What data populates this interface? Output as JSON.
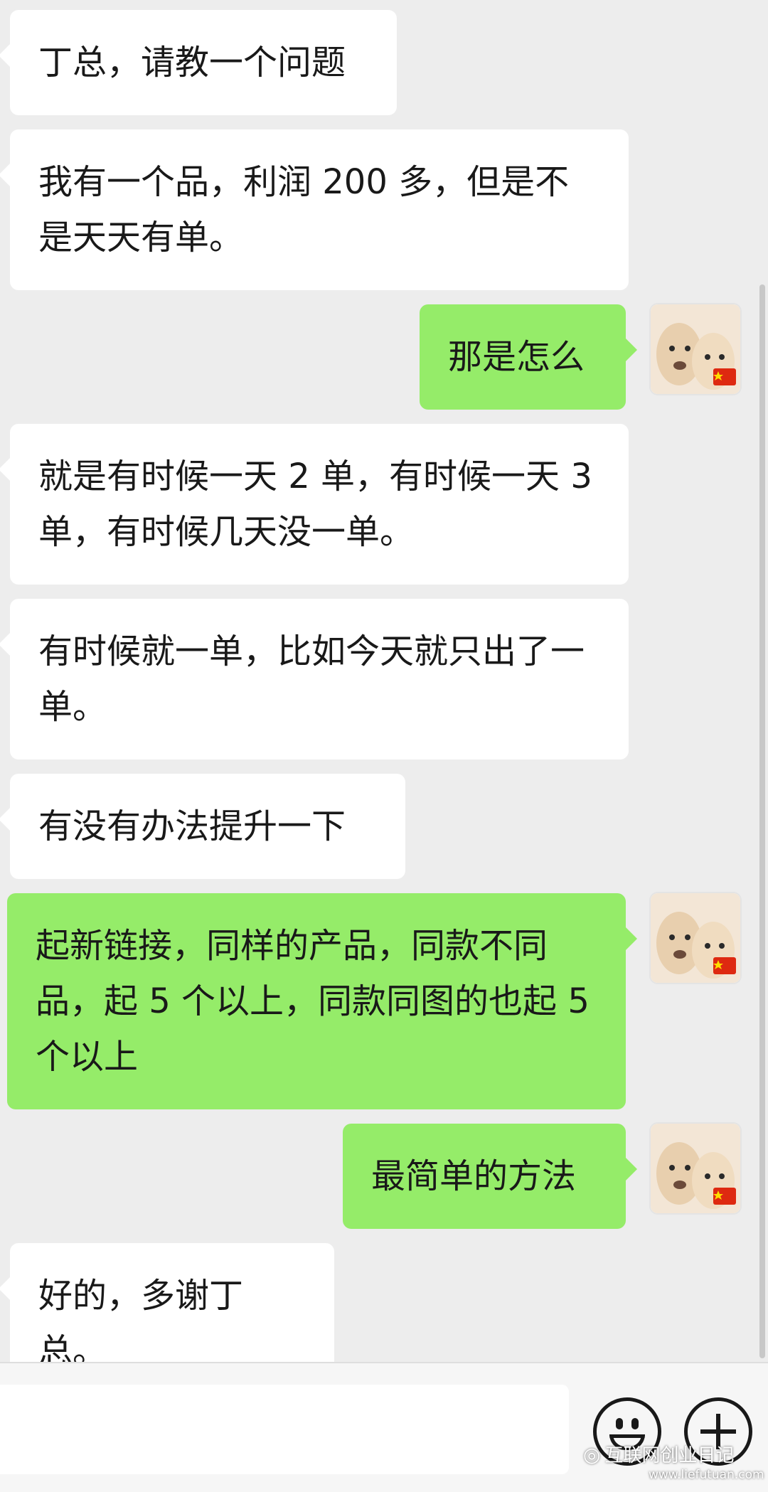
{
  "messages": [
    {
      "side": "in",
      "text": "丁总，请教一个问题"
    },
    {
      "side": "in",
      "text": "我有一个品，利润 200 多，但是不是天天有单。"
    },
    {
      "side": "out",
      "text": "那是怎么"
    },
    {
      "side": "in",
      "text": "就是有时候一天 2 单，有时候一天 3 单，有时候几天没一单。"
    },
    {
      "side": "in",
      "text": "有时候就一单，比如今天就只出了一单。"
    },
    {
      "side": "in",
      "text": "有没有办法提升一下"
    },
    {
      "side": "out",
      "text": "起新链接，同样的产品，同款不同品，起 5 个以上，同款同图的也起 5 个以上"
    },
    {
      "side": "out",
      "text": "最简单的方法"
    },
    {
      "side": "in",
      "text": "好的，多谢丁总。"
    }
  ],
  "input": {
    "placeholder": ""
  },
  "toolbar": {
    "emoji_icon": "emoji-icon",
    "plus_icon": "plus-icon"
  },
  "watermark": {
    "name": "互联网创业日记",
    "url": "www.liefutuan.com"
  },
  "colors": {
    "background": "#ededed",
    "incoming": "#ffffff",
    "outgoing": "#95ec69"
  }
}
